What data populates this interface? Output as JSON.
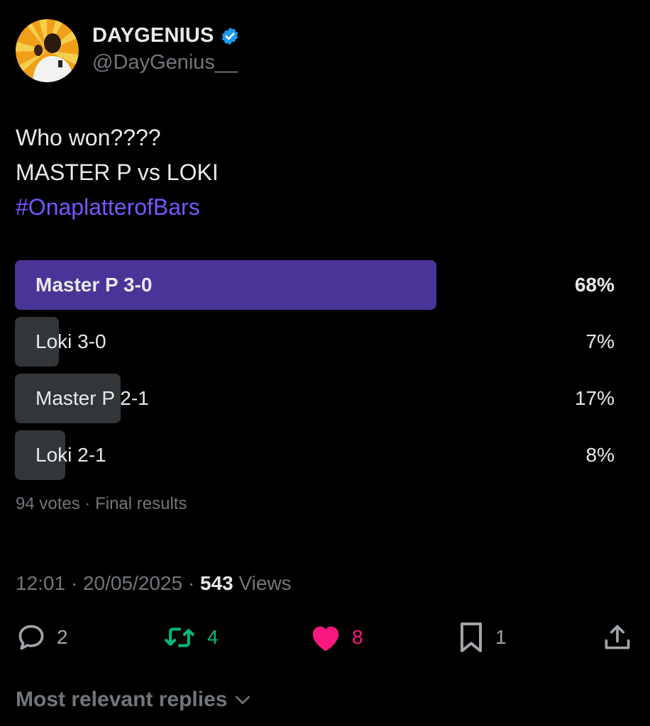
{
  "author": {
    "display_name": "DAYGENIUS",
    "handle": "@DayGenius__",
    "verified": true
  },
  "tweet": {
    "lines": [
      "Who won????",
      "MASTER P vs LOKI"
    ],
    "hashtag": "#OnaplatterofBars"
  },
  "poll": {
    "options": [
      {
        "label": "Master P 3-0",
        "percent": "68%",
        "winner": true
      },
      {
        "label": "Loki 3-0",
        "percent": "7%",
        "winner": false
      },
      {
        "label": "Master P 2-1",
        "percent": "17%",
        "winner": false
      },
      {
        "label": "Loki 2-1",
        "percent": "8%",
        "winner": false
      }
    ],
    "votes": "94 votes",
    "status": "Final results"
  },
  "meta": {
    "time": "12:01",
    "date": "20/05/2025",
    "views_count": "543",
    "views_label": "Views"
  },
  "actions": {
    "replies": "2",
    "reposts": "4",
    "likes": "8",
    "bookmarks": "1"
  },
  "replies_filter": "Most relevant replies",
  "colors": {
    "background": "#000000",
    "accent": "#7856ff",
    "poll_winner": "#4a3497",
    "poll_other": "#333639",
    "repost_green": "#00ba7c",
    "like_pink": "#f91880",
    "verified_blue": "#1d9bf0",
    "muted": "#71767b"
  }
}
